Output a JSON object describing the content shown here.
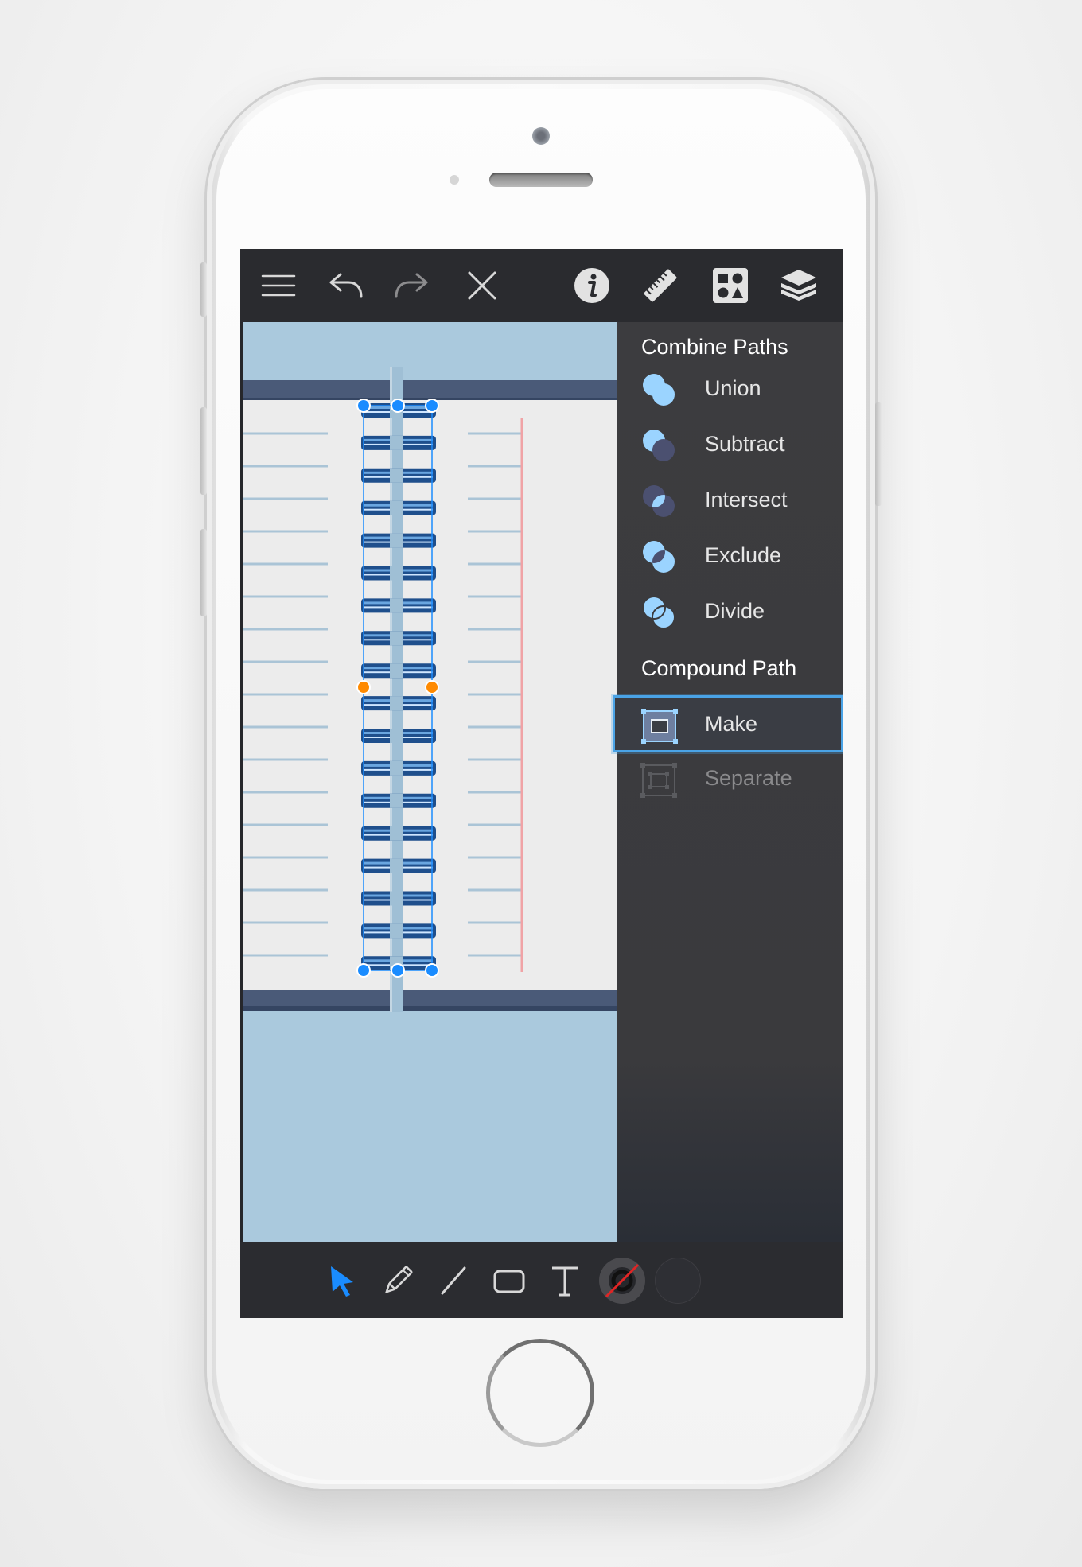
{
  "toolbar": {
    "icons": [
      "menu-icon",
      "undo-icon",
      "redo-icon",
      "close-icon",
      "info-icon",
      "ruler-icon",
      "shapes-icon",
      "layers-icon"
    ]
  },
  "panel": {
    "combine_title": "Combine Paths",
    "combine_items": [
      {
        "label": "Union",
        "icon": "union-icon"
      },
      {
        "label": "Subtract",
        "icon": "subtract-icon"
      },
      {
        "label": "Intersect",
        "icon": "intersect-icon"
      },
      {
        "label": "Exclude",
        "icon": "exclude-icon"
      },
      {
        "label": "Divide",
        "icon": "divide-icon"
      }
    ],
    "compound_title": "Compound Path",
    "compound_items": [
      {
        "label": "Make",
        "icon": "make-compound-icon",
        "selected": true,
        "enabled": true
      },
      {
        "label": "Separate",
        "icon": "separate-compound-icon",
        "selected": false,
        "enabled": false
      }
    ]
  },
  "bottom_tools": {
    "icons": [
      "select-arrow-icon",
      "pencil-icon",
      "line-icon",
      "rectangle-icon",
      "text-icon",
      "stroke-color-swatch",
      "fill-color-swatch"
    ],
    "active": "select-arrow-icon"
  },
  "colors": {
    "accent": "#1a8cff",
    "selection_highlight": "#4aa3e6",
    "canvas_sky": "#aac9dd",
    "notebook_page": "#ececec",
    "notebook_lines": "#aac4d6",
    "margin_line": "#f0a3a6",
    "spiral_dark": "#1f4f8c",
    "handle_blue": "#1a8cff",
    "handle_orange": "#ff8a00"
  }
}
